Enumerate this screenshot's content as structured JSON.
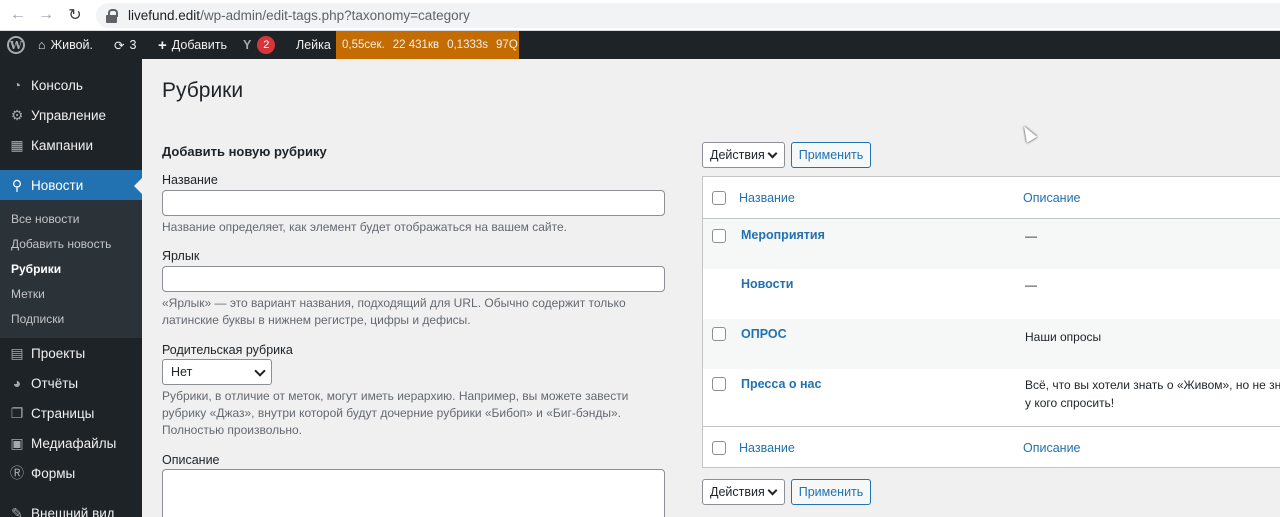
{
  "browser": {
    "url_host": "livefund.edit",
    "url_path": "/wp-admin/edit-tags.php?taxonomy=category"
  },
  "adminbar": {
    "wp_logo": "W",
    "site_name": "Живой.",
    "updates_count": "3",
    "add_label": "Добавить",
    "yoast_badge": "2",
    "leika": "Лейка",
    "qm_time": "0,55сек.",
    "qm_memory": "22 431кв",
    "qm_queries_time": "0,1333s",
    "qm_queries": "97Q"
  },
  "sidebar": {
    "items": [
      {
        "label": "Консоль",
        "icon": "dashboard-icon"
      },
      {
        "label": "Управление",
        "icon": "gear-icon"
      },
      {
        "label": "Кампании",
        "icon": "campaigns-icon"
      },
      {
        "label": "Новости",
        "icon": "pin-icon"
      },
      {
        "label": "Проекты",
        "icon": "projects-icon"
      },
      {
        "label": "Отчёты",
        "icon": "reports-icon"
      },
      {
        "label": "Страницы",
        "icon": "pages-icon"
      },
      {
        "label": "Медиафайлы",
        "icon": "media-icon"
      },
      {
        "label": "Формы",
        "icon": "forms-icon"
      },
      {
        "label": "Внешний вид",
        "icon": "brush-icon"
      }
    ],
    "submenu": [
      "Все новости",
      "Добавить новость",
      "Рубрики",
      "Метки",
      "Подписки"
    ]
  },
  "page": {
    "title": "Рубрики",
    "form_heading": "Добавить новую рубрику",
    "name_label": "Название",
    "name_help": "Название определяет, как элемент будет отображаться на вашем сайте.",
    "slug_label": "Ярлык",
    "slug_help": "«Ярлык» — это вариант названия, подходящий для URL. Обычно содержит только латинские буквы в нижнем регистре, цифры и дефисы.",
    "parent_label": "Родительская рубрика",
    "parent_value": "Нет",
    "parent_help": "Рубрики, в отличие от меток, могут иметь иерархию. Например, вы можете завести рубрику «Джаз», внутри которой будут дочерние рубрики «Бибоп» и «Биг-бэнды». Полностью произвольно.",
    "desc_label": "Описание"
  },
  "table": {
    "bulk_label": "Действия",
    "apply_label": "Применить",
    "col_name": "Название",
    "col_desc": "Описание",
    "rows": [
      {
        "name": "Мероприятия",
        "desc": "—"
      },
      {
        "name": "Новости",
        "desc": "—"
      },
      {
        "name": "ОПРОС",
        "desc": "Наши опросы"
      },
      {
        "name": "Пресса о нас",
        "desc": "Всё, что вы хотели знать о «Живом», но не знали",
        "desc2": "у кого спросить!"
      }
    ]
  }
}
